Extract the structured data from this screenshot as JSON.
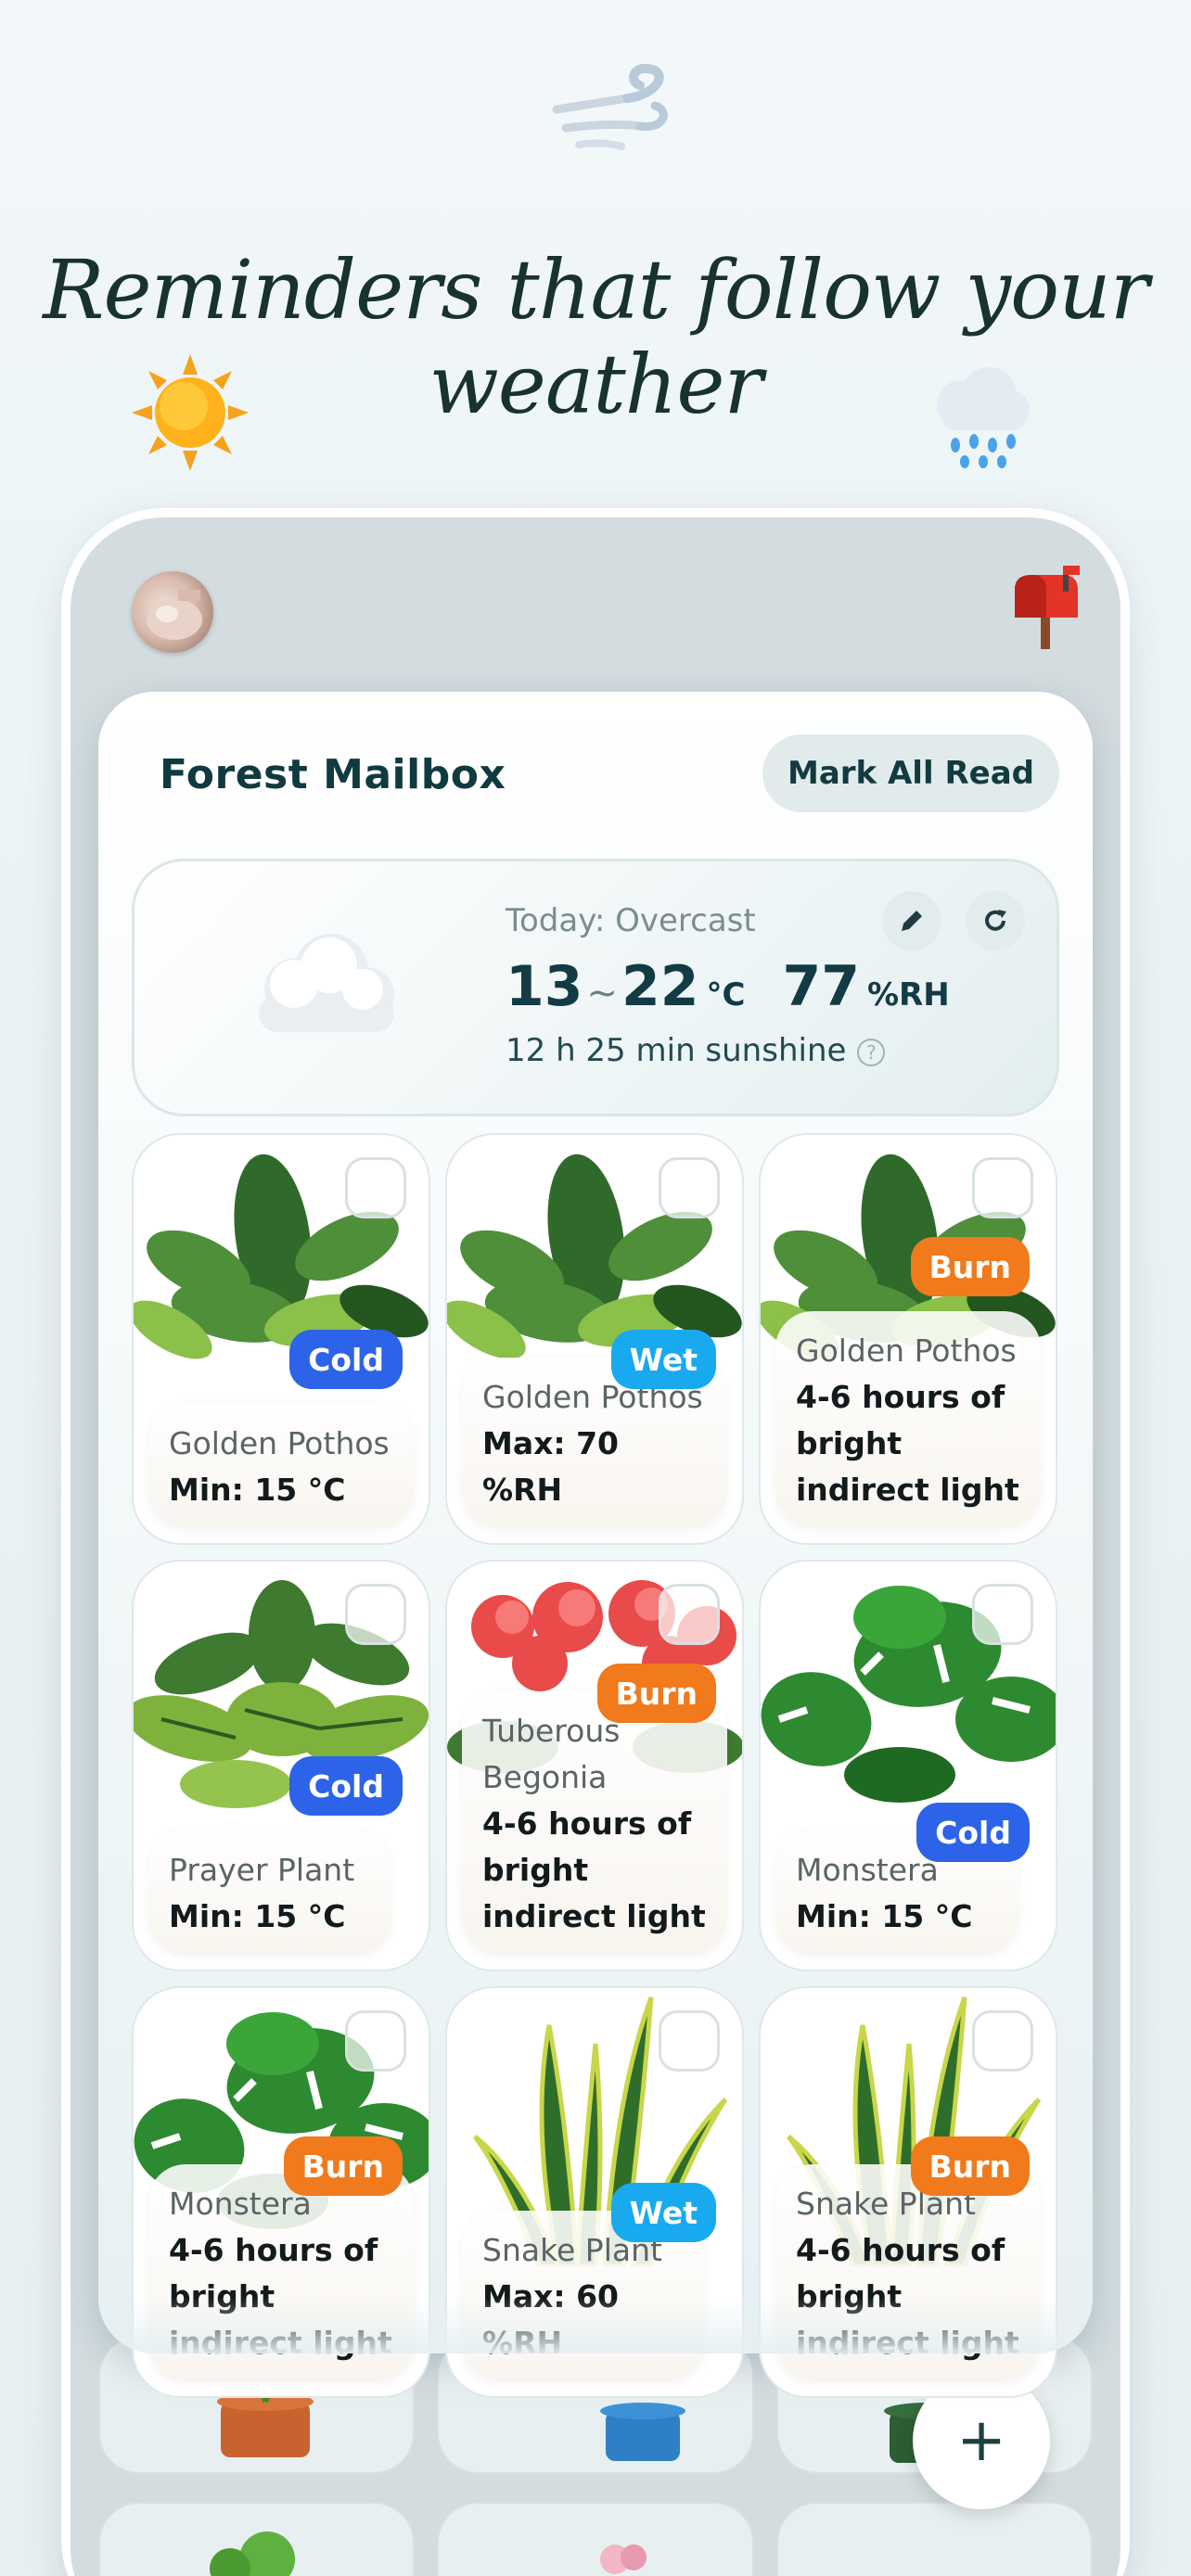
{
  "hero": {
    "headline": "Reminders that follow your weather",
    "icons": [
      "wind-icon",
      "sun-icon",
      "rain-cloud-icon"
    ]
  },
  "app": {
    "header_icons": [
      "avatar",
      "mailbox-icon"
    ],
    "mailbox": {
      "title": "Forest Mailbox",
      "mark_all_read": "Mark All Read"
    },
    "weather": {
      "summary": "Today: Overcast",
      "temp_min": "13",
      "temp_sep": "~",
      "temp_max": "22",
      "temp_unit": "°C",
      "humidity": "77",
      "humidity_unit": "%RH",
      "sunshine": "12 h 25 min sunshine",
      "help": "?",
      "icons": [
        "cloud-icon",
        "edit-icon",
        "refresh-icon",
        "help-icon"
      ]
    },
    "reminders": [
      {
        "plant": "Golden Pothos",
        "badge": "Cold",
        "badge_type": "cold",
        "detail": "Min: 15 °C",
        "art": "pothos"
      },
      {
        "plant": "Golden Pothos",
        "badge": "Wet",
        "badge_type": "wet",
        "detail": "Max: 70 %RH",
        "art": "pothos"
      },
      {
        "plant": "Golden Pothos",
        "badge": "Burn",
        "badge_type": "burn",
        "detail": "4-6 hours of bright indirect light",
        "art": "pothos"
      },
      {
        "plant": "Prayer Plant",
        "badge": "Cold",
        "badge_type": "cold",
        "detail": "Min: 15 °C",
        "art": "prayer"
      },
      {
        "plant": "Tuberous Begonia",
        "badge": "Burn",
        "badge_type": "burn",
        "detail": "4-6 hours of bright indirect light",
        "art": "begonia"
      },
      {
        "plant": "Monstera",
        "badge": "Cold",
        "badge_type": "cold",
        "detail": "Min: 15 °C",
        "art": "monstera"
      },
      {
        "plant": "Monstera",
        "badge": "Burn",
        "badge_type": "burn",
        "detail": "4-6 hours of bright indirect light",
        "art": "monstera"
      },
      {
        "plant": "Snake Plant",
        "badge": "Wet",
        "badge_type": "wet",
        "detail": "Max: 60 %RH",
        "art": "snake"
      },
      {
        "plant": "Snake Plant",
        "badge": "Burn",
        "badge_type": "burn",
        "detail": "4-6 hours of bright indirect light",
        "art": "snake"
      }
    ],
    "fab_label": "+",
    "colors": {
      "cold": "#2d63e8",
      "wet": "#19a9ef",
      "burn": "#f07a1c",
      "title": "#0f3a40"
    }
  }
}
